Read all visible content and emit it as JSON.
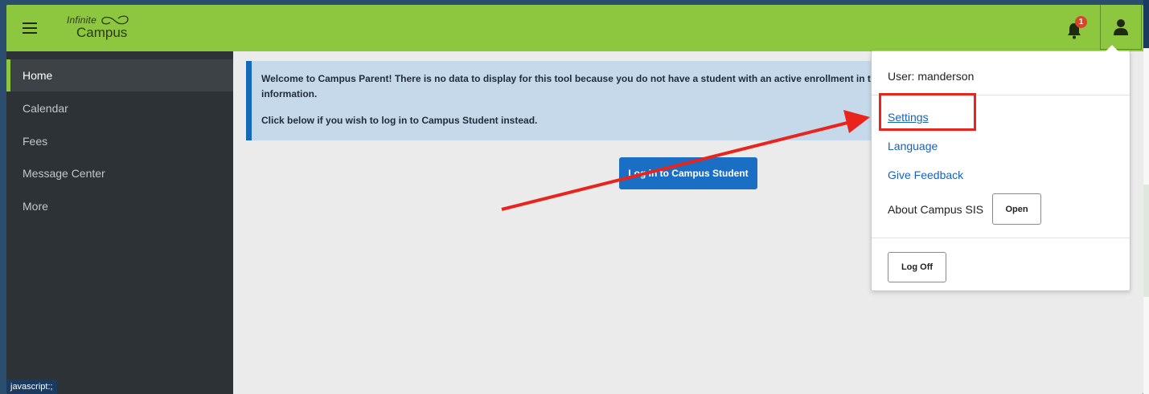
{
  "app": {
    "logo_top": "Infinite",
    "logo_bottom": "Campus",
    "notification_count": "1"
  },
  "sidebar": {
    "items": [
      {
        "label": "Home",
        "active": true
      },
      {
        "label": "Calendar"
      },
      {
        "label": "Fees"
      },
      {
        "label": "Message Center"
      },
      {
        "label": "More"
      }
    ],
    "status_text": "javascript:;"
  },
  "main": {
    "alert_line1": "Welcome to Campus Parent! There is no data to display for this tool because you do not have a student with an active enrollment in thi",
    "alert_line2": "information.",
    "alert_line3": "Click below if you wish to log in to Campus Student instead.",
    "login_button": "Log in to Campus Student"
  },
  "user_menu": {
    "user_label": "User: manderson",
    "settings": "Settings",
    "language": "Language",
    "feedback": "Give Feedback",
    "about": "About Campus SIS",
    "open_button": "Open",
    "logoff_button": "Log Off"
  },
  "colors": {
    "topbar": "#8dc63f",
    "sidebar": "#2d3236",
    "accent_blue": "#1a6fc4",
    "annotation_red": "#e8241c"
  },
  "icons": [
    "hamburger-menu-icon",
    "infinite-campus-logo",
    "bell-icon",
    "user-icon"
  ]
}
